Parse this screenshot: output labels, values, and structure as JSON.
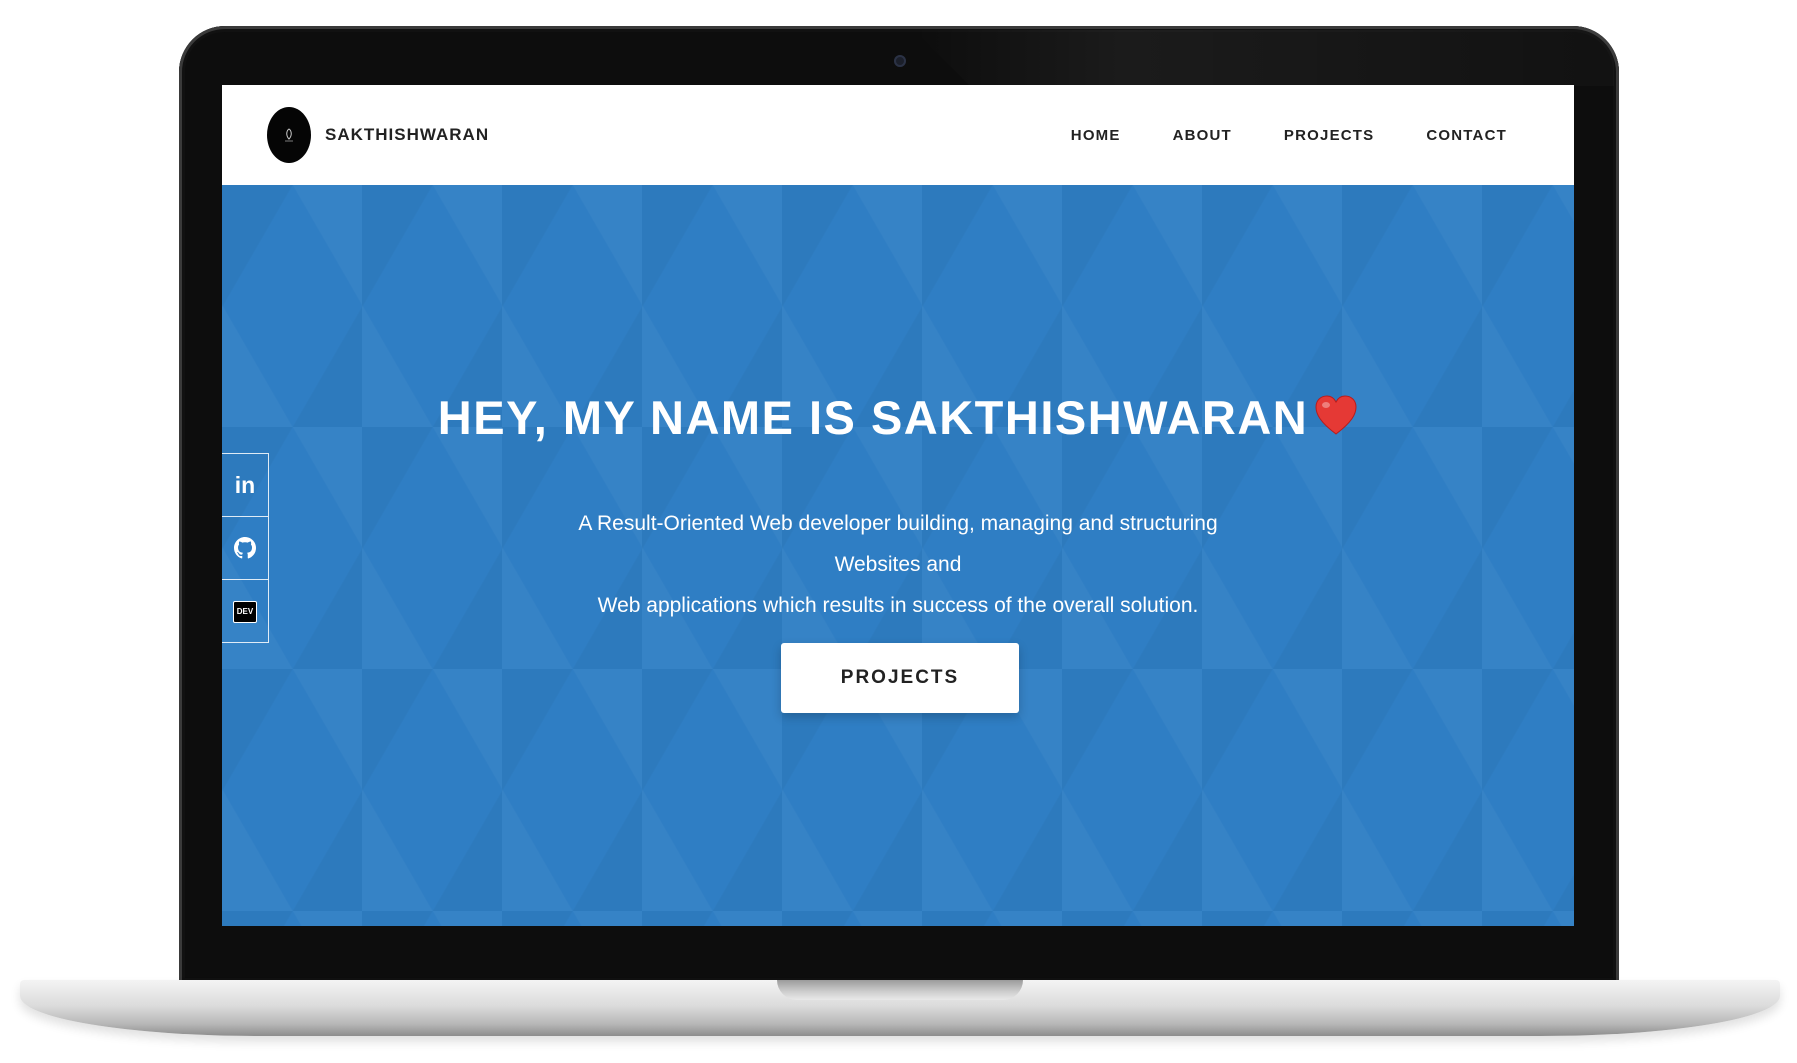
{
  "brand": {
    "name": "SAKTHISHWARAN",
    "logo_icon": "circle-logo-icon"
  },
  "nav": {
    "items": [
      {
        "label": "HOME"
      },
      {
        "label": "ABOUT"
      },
      {
        "label": "PROJECTS"
      },
      {
        "label": "CONTACT"
      }
    ]
  },
  "hero": {
    "title": "HEY, MY NAME IS SAKTHISHWARAN",
    "title_icon": "heart-icon",
    "description_line1": "A Result-Oriented Web developer building, managing and structuring Websites and",
    "description_line2": "Web applications which results in success of the overall solution.",
    "cta_label": "PROJECTS",
    "background_color": "#2f7ec4"
  },
  "social": {
    "items": [
      {
        "icon": "linkedin-icon",
        "text": "in"
      },
      {
        "icon": "github-icon"
      },
      {
        "icon": "dev-icon",
        "text": "DEV"
      }
    ]
  },
  "colors": {
    "accent": "#2f7ec4",
    "heart": "#e53935",
    "text_dark": "#222222",
    "white": "#ffffff"
  }
}
